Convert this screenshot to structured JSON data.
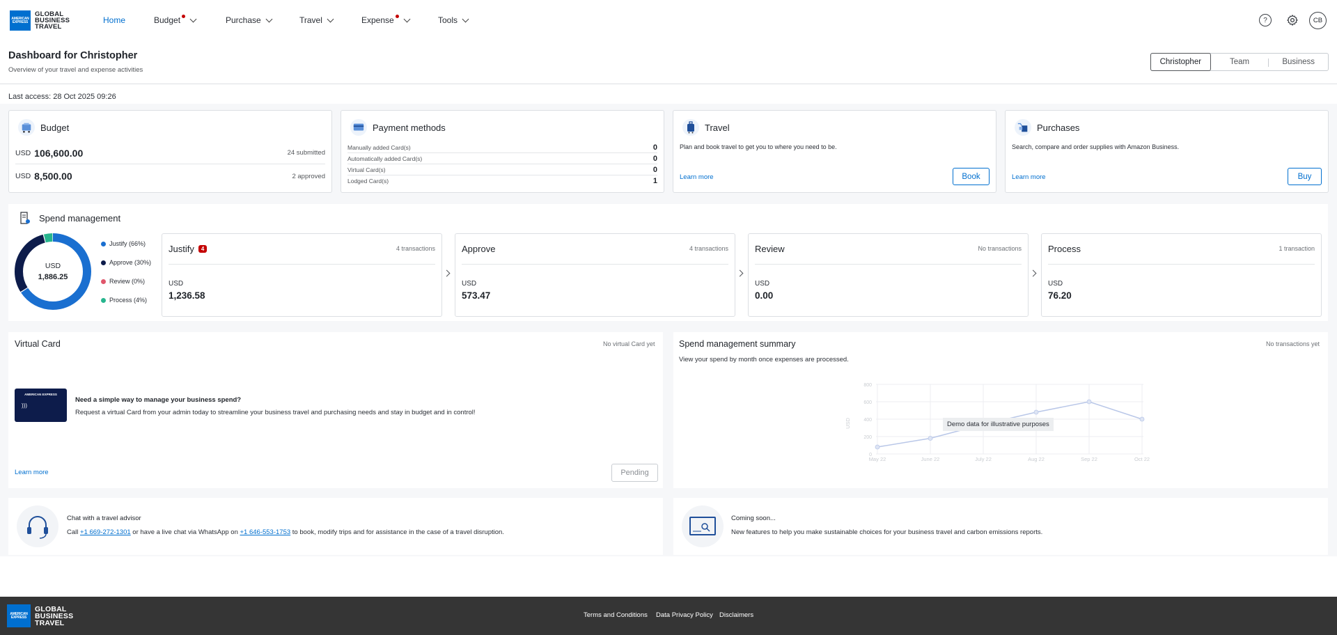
{
  "brand": {
    "logo_line1": "GLOBAL",
    "logo_line2": "BUSINESS",
    "logo_line3": "TRAVEL",
    "logo_box": "AMERICAN EXPRESS",
    "color": "#006fcf"
  },
  "nav": {
    "home": "Home",
    "budget": "Budget",
    "purchase": "Purchase",
    "travel": "Travel",
    "expense": "Expense",
    "tools": "Tools",
    "help_icon": "?",
    "avatar": "CB"
  },
  "header": {
    "title": "Dashboard for Christopher",
    "subtitle": "Overview of your travel and expense activities",
    "scopes": [
      "Christopher",
      "Team",
      "Business"
    ],
    "selected_scope": "Christopher"
  },
  "last_access": "Last access: 28 Oct 2025 09:26",
  "budget": {
    "title": "Budget",
    "rows": [
      {
        "currency": "USD",
        "amount": "106,600.00",
        "meta": "24 submitted"
      },
      {
        "currency": "USD",
        "amount": "8,500.00",
        "meta": "2 approved"
      }
    ]
  },
  "payment": {
    "title": "Payment methods",
    "rows": [
      {
        "label": "Manually added Card(s)",
        "value": "0"
      },
      {
        "label": "Automatically added Card(s)",
        "value": "0"
      },
      {
        "label": "Virtual Card(s)",
        "value": "0"
      },
      {
        "label": "Lodged Card(s)",
        "value": "1"
      }
    ]
  },
  "travel_card": {
    "title": "Travel",
    "text": "Plan and book travel to get you to where you need to be.",
    "link": "Learn more",
    "button": "Book"
  },
  "purchases": {
    "title": "Purchases",
    "text": "Search, compare and order supplies with Amazon Business.",
    "link": "Learn more",
    "button": "Buy"
  },
  "spend": {
    "title": "Spend management",
    "donut_currency": "USD",
    "donut_total": "1,886.25",
    "segments": [
      {
        "label": "Justify (66%)",
        "percent": 66,
        "color": "#1a6fd0"
      },
      {
        "label": "Approve (30%)",
        "percent": 30,
        "color": "#0d1c4b"
      },
      {
        "label": "Review (0%)",
        "percent": 0,
        "color": "#e0566b"
      },
      {
        "label": "Process (4%)",
        "percent": 4,
        "color": "#27b58e"
      }
    ],
    "stages": [
      {
        "title": "Justify",
        "badge": "4",
        "count": "4 transactions",
        "currency": "USD",
        "amount": "1,236.58"
      },
      {
        "title": "Approve",
        "badge": "",
        "count": "4 transactions",
        "currency": "USD",
        "amount": "573.47"
      },
      {
        "title": "Review",
        "badge": "",
        "count": "No transactions",
        "currency": "USD",
        "amount": "0.00"
      },
      {
        "title": "Process",
        "badge": "",
        "count": "1 transaction",
        "currency": "USD",
        "amount": "76.20"
      }
    ]
  },
  "virtual_card": {
    "title": "Virtual Card",
    "meta": "No virtual Card yet",
    "card_brand": "AMERICAN EXPRESS",
    "heading": "Need a simple way to manage your business spend?",
    "text": "Request a virtual Card from your admin today to streamline your business travel and purchasing needs and stay in budget and in control!",
    "link": "Learn more",
    "button": "Pending"
  },
  "summary": {
    "title": "Spend management summary",
    "meta": "No transactions yet",
    "subtitle": "View your spend by month once expenses are processed.",
    "overlay": "Demo data for illustrative purposes"
  },
  "chart_data": {
    "type": "line",
    "x": [
      "May 22",
      "June 22",
      "July 22",
      "Aug 22",
      "Sep 22",
      "Oct 22"
    ],
    "series": [
      {
        "values": [
          80,
          180,
          340,
          480,
          600,
          400
        ]
      }
    ],
    "ylabel": "USD",
    "yticks": [
      "800",
      "600",
      "400",
      "200",
      "0"
    ],
    "ylim": [
      0,
      800
    ],
    "grid": true,
    "color": "#b9c7e8"
  },
  "advisor": {
    "title": "Chat with a travel advisor",
    "call": "Call",
    "phone1": "+1 669-272-1301",
    "mid": "or have a live chat via WhatsApp on",
    "phone2": "+1 646-553-1753",
    "tail": "to book, modify trips and for assistance in the case of a travel disruption."
  },
  "coming_soon": {
    "title": "Coming soon...",
    "text": "New features to help you make sustainable choices for your business travel and carbon emissions reports."
  },
  "footer": {
    "links": [
      "Terms and Conditions",
      "Data Privacy Policy",
      "Disclaimers"
    ]
  }
}
